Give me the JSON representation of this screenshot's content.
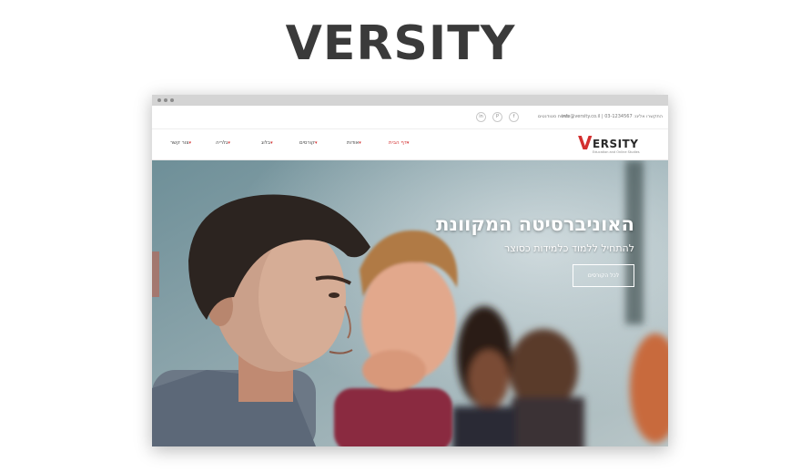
{
  "page": {
    "heading": "VERSITY"
  },
  "topbar": {
    "contact_text": "התקשרו אלינו: 03-1234567 | info@versity.co.il",
    "login_text": "כניסת סטודנטים",
    "social": [
      {
        "icon": "linkedin-icon",
        "glyph": "in"
      },
      {
        "icon": "pinterest-icon",
        "glyph": "P"
      },
      {
        "icon": "facebook-icon",
        "glyph": "f"
      }
    ]
  },
  "logo": {
    "initial": "V",
    "rest": "ERSITY",
    "tagline": "Education and Online Studies"
  },
  "nav": {
    "items": [
      {
        "label": "דף הבית",
        "active": true
      },
      {
        "label": "אודות",
        "active": false
      },
      {
        "label": "קורסים",
        "active": false
      },
      {
        "label": "בלוג",
        "active": false
      },
      {
        "label": "גלריה",
        "active": false
      },
      {
        "label": "צור קשר",
        "active": false
      }
    ]
  },
  "hero": {
    "title": "האוניברסיטה המקוונת",
    "subtitle": "להתחיל ללמוד כלמידות כסוצר",
    "cta_label": "לכל הקורסים"
  },
  "colors": {
    "accent": "#d32f2f",
    "heading": "#3a3a3a"
  }
}
